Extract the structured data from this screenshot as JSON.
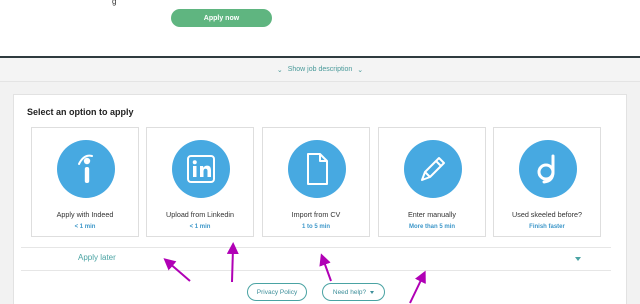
{
  "header": {
    "apply_now_label": "Apply now",
    "title_fragment": "g"
  },
  "show_job_description": "Show job description",
  "panel": {
    "title": "Select an option to apply",
    "options": [
      {
        "label": "Apply with Indeed",
        "sub": "< 1 min",
        "icon": "indeed-icon"
      },
      {
        "label": "Upload from Linkedin",
        "sub": "< 1 min",
        "icon": "linkedin-icon"
      },
      {
        "label": "Import from CV",
        "sub": "1 to 5 min",
        "icon": "document-icon"
      },
      {
        "label": "Enter manually",
        "sub": "More than 5 min",
        "icon": "pencil-icon"
      },
      {
        "label": "Used skeeled before?",
        "sub": "Finish faster",
        "icon": "skeeled-icon"
      }
    ],
    "apply_later": "Apply later"
  },
  "footer": {
    "privacy_policy": "Privacy Policy",
    "need_help": "Need help?"
  },
  "colors": {
    "accent_green": "#5fb580",
    "icon_blue": "#47a9e1",
    "teal_text": "#4aa3a3",
    "annotation_arrow": "#b000b5"
  }
}
